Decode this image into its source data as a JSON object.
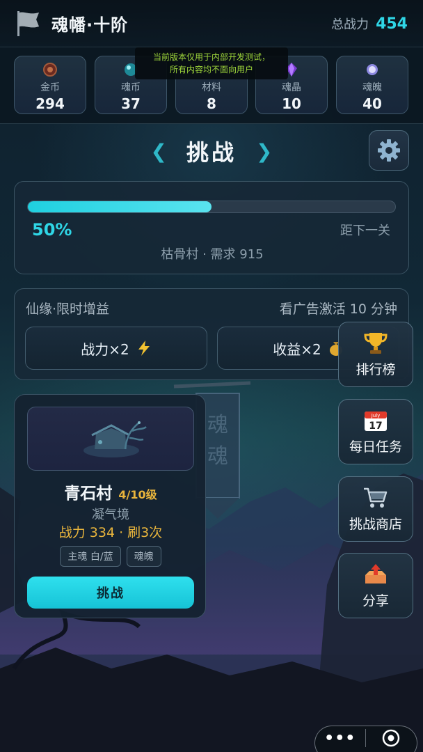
{
  "header": {
    "title": "魂幡·十阶",
    "power_label": "总战力",
    "power_value": "454",
    "flag_icon": "flag-icon"
  },
  "dev_notice": {
    "line1": "当前版本仅用于内部开发测试，",
    "line2": "所有内容均不面向用户"
  },
  "resources": [
    {
      "label": "金币",
      "value": "294",
      "icon": "coin-icon",
      "color": "#7a2e22"
    },
    {
      "label": "魂币",
      "value": "37",
      "icon": "soul-coin-icon",
      "color": "#2fb8c8"
    },
    {
      "label": "材料",
      "value": "8",
      "icon": "material-icon",
      "color": "#8a7a5a"
    },
    {
      "label": "魂晶",
      "value": "10",
      "icon": "soul-crystal-icon",
      "color": "#8a4fd8"
    },
    {
      "label": "魂魄",
      "value": "40",
      "icon": "soul-spirit-icon",
      "color": "#b9b4ff"
    }
  ],
  "challenge": {
    "title": "挑战",
    "prev_glyph": "❮",
    "next_glyph": "❯"
  },
  "progress": {
    "percent": 0.5,
    "percent_label": "50%",
    "next_label": "距下一关",
    "requirement": "枯骨村 · 需求 915"
  },
  "buff": {
    "title": "仙缘·限时增益",
    "hint": "看广告激活 10 分钟",
    "power_btn": "战力×2",
    "income_btn": "收益×2"
  },
  "side_menu": {
    "ranking": "排行榜",
    "daily": "每日任务",
    "calendar_month": "July",
    "calendar_day": "17",
    "shop": "挑战商店",
    "share": "分享"
  },
  "stage": {
    "name": "青石村",
    "level": "4/10级",
    "realm": "凝气境",
    "stats": "战力 334 · 刷3次",
    "tags": [
      "主魂 白/蓝",
      "魂魄"
    ],
    "button": "挑战"
  },
  "capsule": {
    "more": "•••"
  },
  "colors": {
    "accent": "#2fd6e6",
    "gold": "#e9b53c",
    "notice": "#9fd73b"
  }
}
